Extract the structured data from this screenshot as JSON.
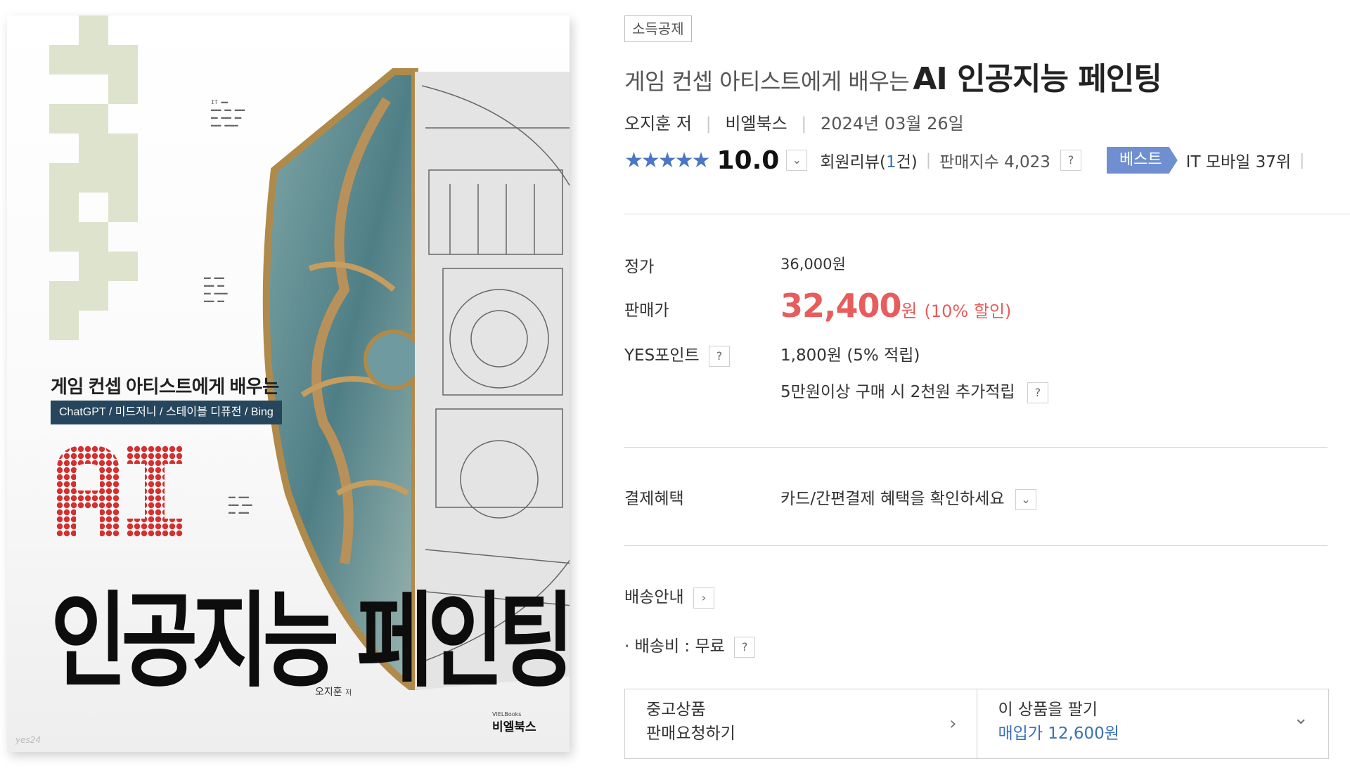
{
  "cover": {
    "subtitle": "게임 컨셉 아티스트에게 배우는",
    "tag": "ChatGPT / 미드저니 / 스테이블 디퓨전 / Bing",
    "ai_text": "AI",
    "title": "인공지능 페인팅",
    "author": "오지훈",
    "author_suffix": "저",
    "publisher_small": "VIELBooks",
    "publisher": "비엘북스",
    "mark": "yes24"
  },
  "product": {
    "badge": "소득공제",
    "title_prefix": "게임 컨셉 아티스트에게 배우는",
    "title_main": "AI 인공지능 페인팅",
    "author": "오지훈 저",
    "publisher": "비엘북스",
    "date": "2024년 03월 26일",
    "stars": "★★★★★",
    "score": "10.0",
    "review_label": "회원리뷰(",
    "review_count": "1",
    "review_suffix": "건)",
    "sales_index": "판매지수 4,023",
    "best_label": "베스트",
    "rank": "IT 모바일 37위",
    "help_icon": "?",
    "dropdown_icon": "⌄"
  },
  "price": {
    "list_label": "정가",
    "list_value": "36,000원",
    "sale_label": "판매가",
    "sale_value": "32,400",
    "sale_unit": "원",
    "discount": "(10% 할인)",
    "point_label": "YES포인트",
    "point_value": "1,800원 (5% 적립)",
    "extra_point": "5만원이상 구매 시 2천원 추가적립"
  },
  "payment": {
    "label": "결제혜택",
    "value": "카드/간편결제 혜택을 확인하세요"
  },
  "delivery": {
    "label": "배송안내",
    "fee_bullet": "·",
    "fee": "배송비 : 무료"
  },
  "used": {
    "line1": "중고상품",
    "line2": "판매요청하기",
    "chevron": "›"
  },
  "sell": {
    "line1": "이 상품을 팔기",
    "line2": "매입가 12,600원",
    "chevron": "⌄"
  },
  "colors": {
    "sale_red": "#e85c5c",
    "star_blue": "#4a77c2",
    "link_blue": "#3a70b8",
    "best_tag": "#6f8fd0"
  }
}
